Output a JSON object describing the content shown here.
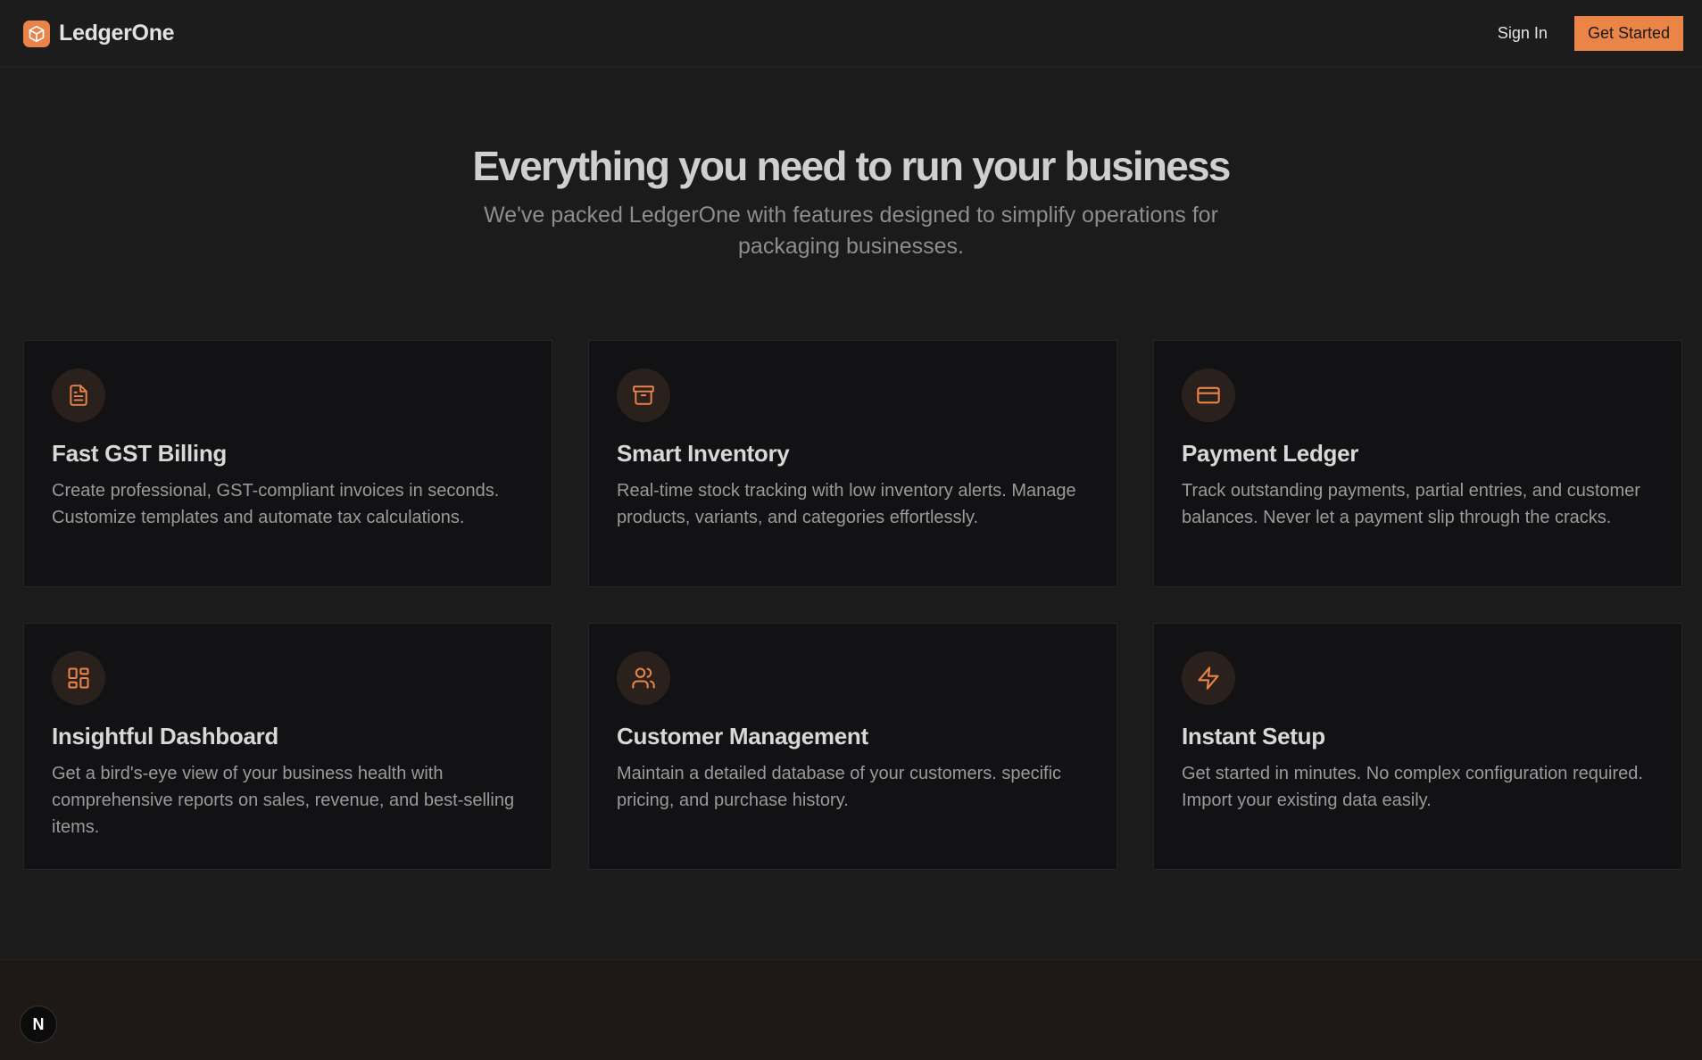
{
  "nav": {
    "brand": "LedgerOne",
    "sign_in": "Sign In",
    "get_started": "Get Started"
  },
  "hero": {
    "title": "Everything you need to run your business",
    "subtitle": "We've packed LedgerOne with features designed to simplify operations for packaging businesses."
  },
  "features": [
    {
      "icon": "file-text-icon",
      "title": "Fast GST Billing",
      "text": "Create professional, GST-compliant invoices in seconds. Customize templates and automate tax calculations."
    },
    {
      "icon": "archive-icon",
      "title": "Smart Inventory",
      "text": "Real-time stock tracking with low inventory alerts. Manage products, variants, and categories effortlessly."
    },
    {
      "icon": "credit-card-icon",
      "title": "Payment Ledger",
      "text": "Track outstanding payments, partial entries, and customer balances. Never let a payment slip through the cracks."
    },
    {
      "icon": "dashboard-grid-icon",
      "title": "Insightful Dashboard",
      "text": "Get a bird's-eye view of your business health with comprehensive reports on sales, revenue, and best-selling items."
    },
    {
      "icon": "users-icon",
      "title": "Customer Management",
      "text": "Maintain a detailed database of your customers. specific pricing, and purchase history."
    },
    {
      "icon": "zap-icon",
      "title": "Instant Setup",
      "text": "Get started in minutes. No complex configuration required. Import your existing data easily."
    }
  ],
  "badge": "N",
  "colors": {
    "accent": "#ea8447",
    "background": "#1b1b1c",
    "card": "#121214",
    "icon_bg": "#2a211d"
  }
}
